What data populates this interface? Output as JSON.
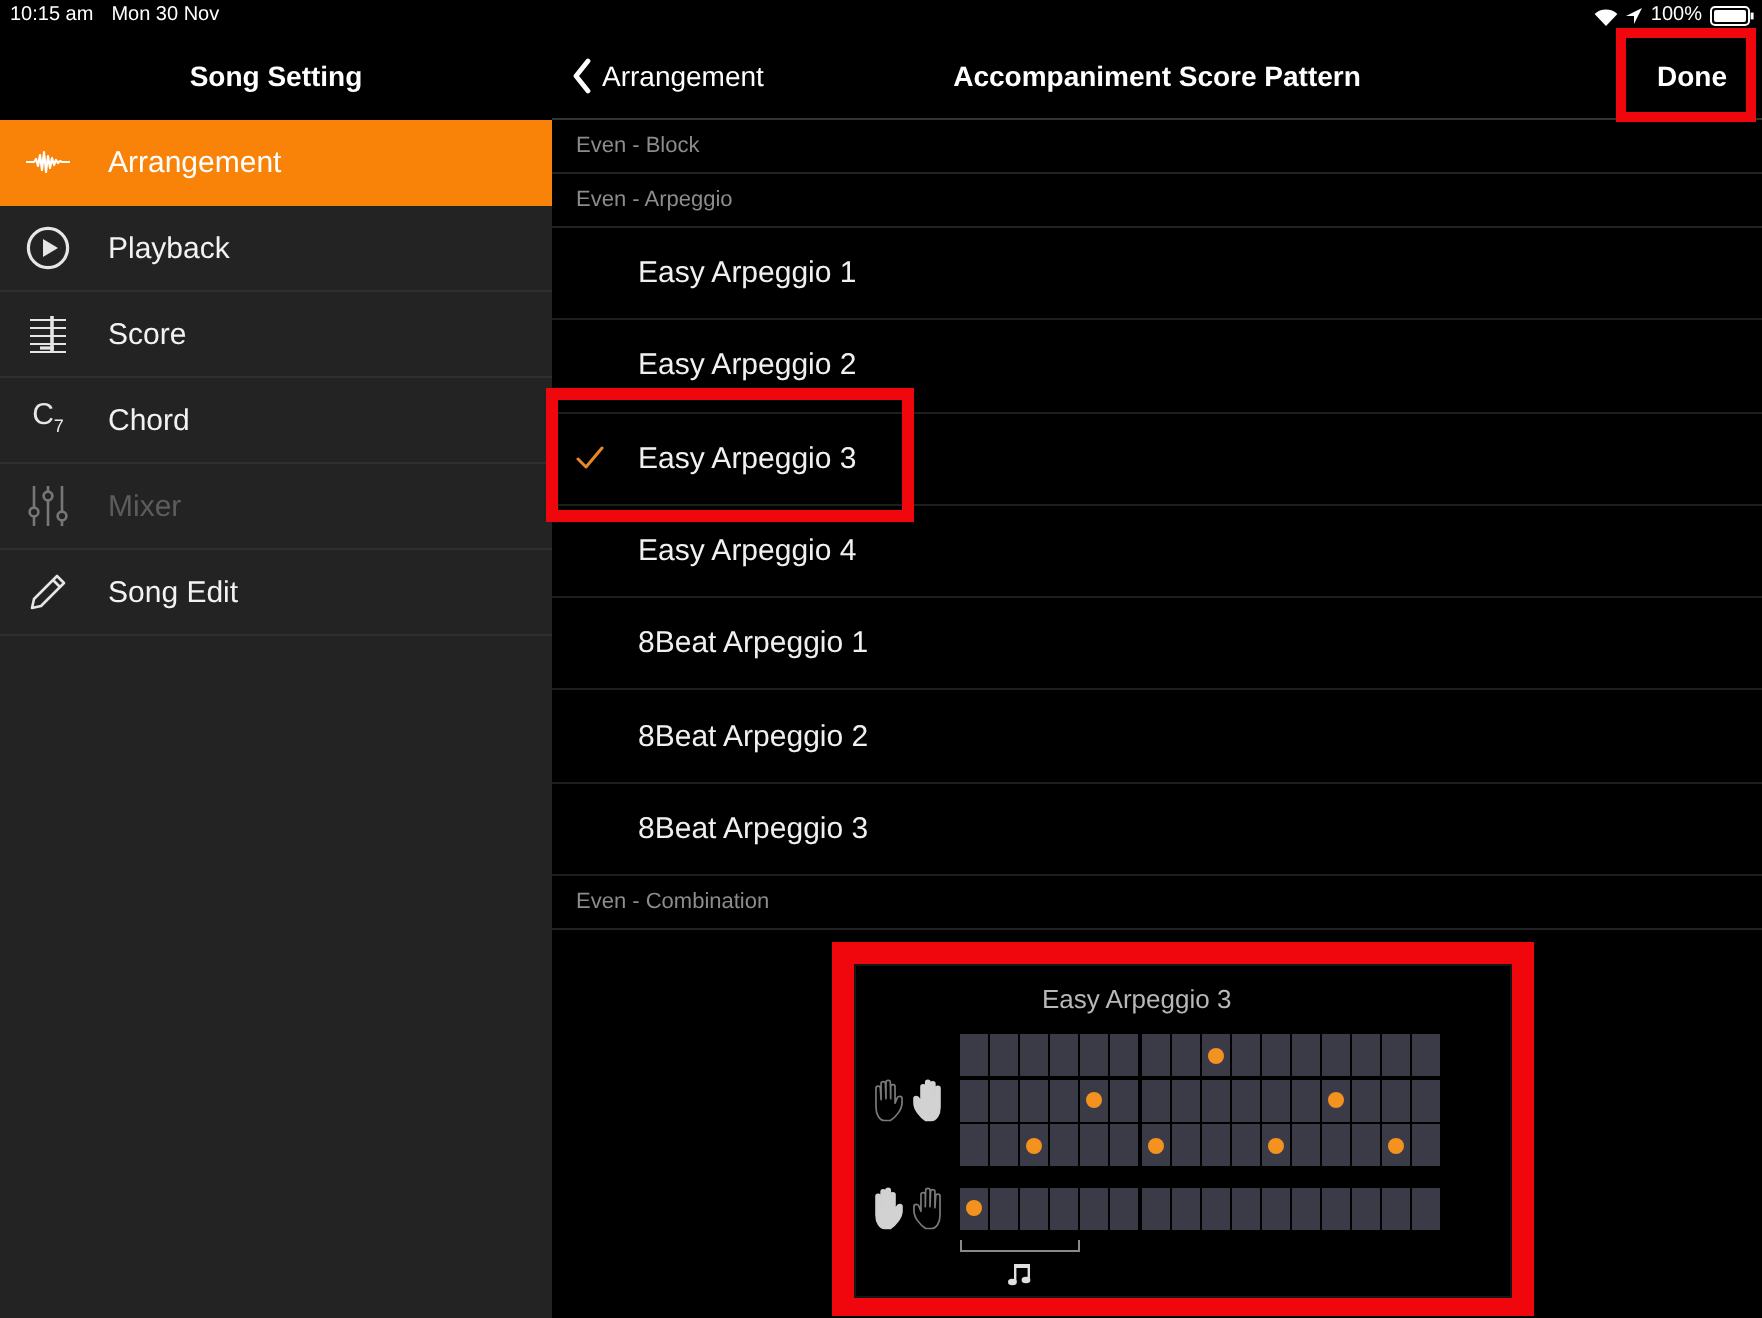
{
  "status_bar": {
    "time": "10:15 am",
    "date": "Mon 30 Nov",
    "battery": "100%"
  },
  "sidebar": {
    "title": "Song Setting",
    "items": [
      {
        "label": "Arrangement",
        "selected": true,
        "disabled": false
      },
      {
        "label": "Playback",
        "selected": false,
        "disabled": false
      },
      {
        "label": "Score",
        "selected": false,
        "disabled": false
      },
      {
        "label": "Chord",
        "glyph": "C$_{7}$",
        "selected": false,
        "disabled": false
      },
      {
        "label": "Mixer",
        "selected": false,
        "disabled": true
      },
      {
        "label": "Song Edit",
        "selected": false,
        "disabled": false
      }
    ]
  },
  "nav_bar": {
    "back": "Arrangement",
    "title": "Accompaniment Score Pattern",
    "done_button": {
      "label": "Done",
      "highlighted": true
    }
  },
  "sections": [
    {
      "title": "Even - Block"
    },
    {
      "title": "Even - Arpeggio",
      "items": [
        {
          "label": "Easy Arpeggio 1",
          "selected": false,
          "highlighted": false
        },
        {
          "label": "Easy Arpeggio 2",
          "selected": false,
          "highlighted": false
        },
        {
          "label": "Easy Arpeggio 3",
          "selected": true,
          "highlighted": true
        },
        {
          "label": "Easy Arpeggio 4",
          "selected": false,
          "highlighted": false
        },
        {
          "label": "8Beat Arpeggio 1",
          "selected": false,
          "highlighted": false
        },
        {
          "label": "8Beat Arpeggio 2",
          "selected": false,
          "highlighted": false
        },
        {
          "label": "8Beat Arpeggio 3",
          "selected": false,
          "highlighted": false
        }
      ]
    },
    {
      "title": "Even - Combination"
    }
  ],
  "preview": {
    "title": "Easy Arpeggio 3",
    "highlighted": true,
    "staves": [
      {
        "hands": [
          {
            "on": false
          },
          {
            "on": true
          }
        ],
        "lanes": [
          {
            "notes": [
              false,
              false,
              false,
              false,
              false,
              false,
              false,
              false,
              true,
              false,
              false,
              false,
              false,
              false,
              false,
              false
            ]
          },
          {
            "notes": [
              false,
              false,
              false,
              false,
              true,
              false,
              false,
              false,
              false,
              false,
              false,
              false,
              true,
              false,
              false,
              false
            ]
          },
          {
            "notes": [
              false,
              false,
              true,
              false,
              false,
              false,
              true,
              false,
              false,
              false,
              true,
              false,
              false,
              false,
              true,
              false
            ]
          }
        ]
      },
      {
        "hands": [
          {
            "on": true
          },
          {
            "on": false
          }
        ],
        "lanes": [
          {
            "notes": [
              true,
              false,
              false,
              false,
              false,
              false,
              false,
              false,
              false,
              false,
              false,
              false,
              false,
              false,
              false,
              false
            ]
          }
        ]
      }
    ]
  }
}
